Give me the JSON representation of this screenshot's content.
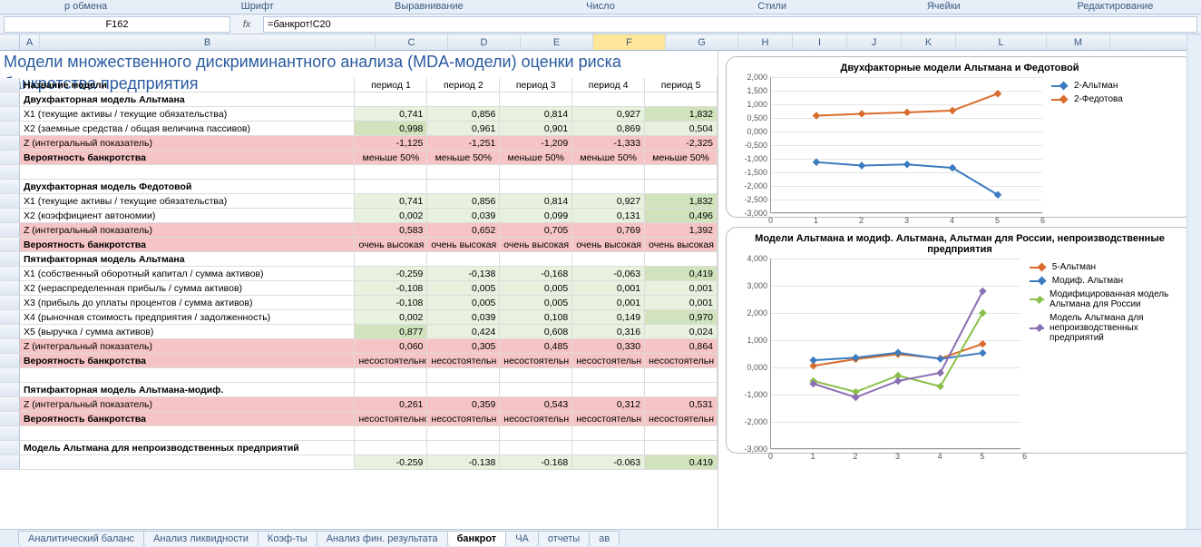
{
  "ribbon": [
    "р обмена",
    "Шрифт",
    "Выравнивание",
    "Число",
    "Стили",
    "Ячейки",
    "Редактирование"
  ],
  "namebox": "F162",
  "fx_label": "fx",
  "formula": "=банкрот!C20",
  "columns": [
    "A",
    "B",
    "C",
    "D",
    "E",
    "F",
    "G",
    "H",
    "I",
    "J",
    "K",
    "L",
    "M"
  ],
  "selected_col": "F",
  "title": "Модели множественного дискриминантного анализа (MDA-модели) оценки риска банкротства предприятия",
  "headers": [
    "Название модели",
    "период 1",
    "период 2",
    "период 3",
    "период 4",
    "период 5"
  ],
  "rows": [
    {
      "type": "section",
      "label": "Двухфакторная модель Альтмана"
    },
    {
      "type": "data",
      "label": "X1 (текущие активы / текущие обязательства)",
      "vals": [
        "0,741",
        "0,856",
        "0,814",
        "0,927",
        "1,832"
      ],
      "shade": [
        0,
        0,
        0,
        0,
        1
      ]
    },
    {
      "type": "data",
      "label": "X2 (заемные средства / общая величина пассивов)",
      "vals": [
        "0,998",
        "0,961",
        "0,901",
        "0,869",
        "0,504"
      ],
      "shade": [
        1,
        0,
        0,
        0,
        0
      ]
    },
    {
      "type": "z",
      "label": "Z (интегральный показатель)",
      "vals": [
        "-1,125",
        "-1,251",
        "-1,209",
        "-1,333",
        "-2,325"
      ]
    },
    {
      "type": "prob",
      "label": "Вероятность банкротства",
      "vals": [
        "меньше 50%",
        "меньше 50%",
        "меньше 50%",
        "меньше 50%",
        "меньше 50%"
      ]
    },
    {
      "type": "blank"
    },
    {
      "type": "section",
      "label": "Двухфакторная модель Федотовой"
    },
    {
      "type": "data",
      "label": "X1 (текущие активы / текущие обязательства)",
      "vals": [
        "0,741",
        "0,856",
        "0,814",
        "0,927",
        "1,832"
      ],
      "shade": [
        0,
        0,
        0,
        0,
        1
      ]
    },
    {
      "type": "data",
      "label": "X2 (коэффициент автономии)",
      "vals": [
        "0,002",
        "0,039",
        "0,099",
        "0,131",
        "0,496"
      ],
      "shade": [
        0,
        0,
        0,
        0,
        1
      ]
    },
    {
      "type": "z",
      "label": "Z (интегральный показатель)",
      "vals": [
        "0,583",
        "0,652",
        "0,705",
        "0,769",
        "1,392"
      ]
    },
    {
      "type": "prob",
      "label": "Вероятность банкротства",
      "vals": [
        "очень высокая",
        "очень высокая",
        "очень высокая",
        "очень высокая",
        "очень высокая"
      ]
    },
    {
      "type": "section",
      "label": "Пятифакторная модель Альтмана"
    },
    {
      "type": "data",
      "label": "X1 (собственный оборотный капитал / сумма активов)",
      "vals": [
        "-0,259",
        "-0,138",
        "-0,168",
        "-0,063",
        "0,419"
      ],
      "shade": [
        0,
        0,
        0,
        0,
        1
      ]
    },
    {
      "type": "data",
      "label": "X2 (нераспределенная прибыль / сумма активов)",
      "vals": [
        "-0,108",
        "0,005",
        "0,005",
        "0,001",
        "0,001"
      ],
      "shade": [
        0,
        0,
        0,
        0,
        0
      ]
    },
    {
      "type": "data",
      "label": "X3 (прибыль до уплаты процентов / сумма активов)",
      "vals": [
        "-0,108",
        "0,005",
        "0,005",
        "0,001",
        "0,001"
      ],
      "shade": [
        0,
        0,
        0,
        0,
        0
      ]
    },
    {
      "type": "data",
      "label": "X4 (рыночная стоимость предприятия / задолженность)",
      "vals": [
        "0,002",
        "0,039",
        "0,108",
        "0,149",
        "0,970"
      ],
      "shade": [
        0,
        0,
        0,
        0,
        1
      ]
    },
    {
      "type": "data",
      "label": "X5 (выручка / сумма активов)",
      "vals": [
        "0,877",
        "0,424",
        "0,608",
        "0,316",
        "0,024"
      ],
      "shade": [
        1,
        0,
        0,
        0,
        0
      ]
    },
    {
      "type": "z",
      "label": "Z (интегральный показатель)",
      "vals": [
        "0,060",
        "0,305",
        "0,485",
        "0,330",
        "0,864"
      ]
    },
    {
      "type": "prob",
      "label": "Вероятность банкротства",
      "vals": [
        "несостоятельно",
        "несостоятельн",
        "несостоятельн",
        "несостоятельн",
        "несостоятельн"
      ]
    },
    {
      "type": "blank"
    },
    {
      "type": "section",
      "label": "Пятифакторная модель Альтмана-модиф."
    },
    {
      "type": "z",
      "label": "Z (интегральный показатель)",
      "vals": [
        "0,261",
        "0,359",
        "0,543",
        "0,312",
        "0,531"
      ]
    },
    {
      "type": "prob",
      "label": "Вероятность банкротства",
      "vals": [
        "несостоятельно",
        "несостоятельн",
        "несостоятельн",
        "несостоятельн",
        "несостоятельн"
      ]
    },
    {
      "type": "blank"
    },
    {
      "type": "section",
      "label": "Модель Альтмана для непроизводственных предприятий"
    },
    {
      "type": "data",
      "label": "",
      "vals": [
        "-0.259",
        "-0.138",
        "-0.168",
        "-0.063",
        "0.419"
      ],
      "shade": [
        0,
        0,
        0,
        0,
        1
      ]
    }
  ],
  "chart_data": [
    {
      "type": "line",
      "title": "Двухфакторные модели Альтмана и Федотовой",
      "x": [
        1,
        2,
        3,
        4,
        5
      ],
      "xlim": [
        0,
        6
      ],
      "ylim": [
        -3.0,
        2.0
      ],
      "ystep": 0.5,
      "series": [
        {
          "name": "2-Альтман",
          "color": "#3b7bbf",
          "values": [
            -1.125,
            -1.251,
            -1.209,
            -1.333,
            -2.325
          ]
        },
        {
          "name": "2-Федотова",
          "color": "#d96b2b",
          "values": [
            0.583,
            0.652,
            0.705,
            0.769,
            1.392
          ]
        }
      ]
    },
    {
      "type": "line",
      "title": "Модели Альтмана и модиф. Альтмана, Альтман для России, непроизводственные предприятия",
      "x": [
        1,
        2,
        3,
        4,
        5
      ],
      "xlim": [
        0,
        6
      ],
      "ylim": [
        -3.0,
        4.0
      ],
      "ystep": 1.0,
      "series": [
        {
          "name": "5-Альтман",
          "color": "#d96b2b",
          "values": [
            0.06,
            0.305,
            0.485,
            0.33,
            0.864
          ]
        },
        {
          "name": "Модиф. Альтман",
          "color": "#3b7bbf",
          "values": [
            0.261,
            0.359,
            0.543,
            0.312,
            0.531
          ]
        },
        {
          "name": "Модифицированная модель Альтмана для России",
          "color": "#8bbf4b",
          "values": [
            -0.5,
            -0.9,
            -0.3,
            -0.7,
            2.0
          ]
        },
        {
          "name": "Модель Альтмана для непроизводственных предприятий",
          "color": "#8a6fb3",
          "values": [
            -0.6,
            -1.1,
            -0.5,
            -0.2,
            2.8
          ]
        }
      ]
    }
  ],
  "tabs": [
    "Аналитический баланс",
    "Анализ ликвидности",
    "Коэф-ты",
    "Анализ фин. результата",
    "банкрот",
    "ЧА",
    "отчеты",
    "ав"
  ],
  "active_tab": "банкрот"
}
